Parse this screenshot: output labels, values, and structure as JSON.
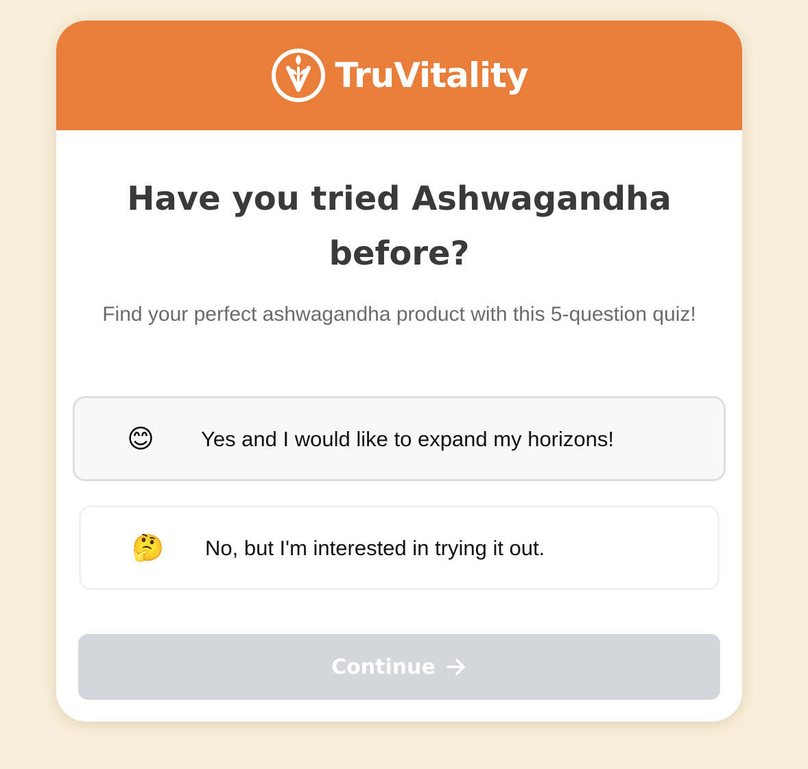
{
  "brand": {
    "name": "TruVitality",
    "logo_icon": "leaf-v-circle-icon",
    "header_color": "#e87e39"
  },
  "question": {
    "title": "Have you tried Ashwagandha before?",
    "subtitle": "Find your perfect ashwagandha product with this 5-question quiz!"
  },
  "options": [
    {
      "emoji": "😊",
      "emoji_icon": "smiling-face-icon",
      "label": "Yes and I would like to expand my horizons!",
      "state": "hovered"
    },
    {
      "emoji": "🤔",
      "emoji_icon": "thinking-face-icon",
      "label": "No, but I'm interested in trying it out.",
      "state": "default"
    }
  ],
  "continue": {
    "label": "Continue",
    "icon": "arrow-right-icon",
    "disabled": true
  },
  "colors": {
    "page_background": "#f8eed9",
    "button_disabled": "#d4d6db"
  }
}
